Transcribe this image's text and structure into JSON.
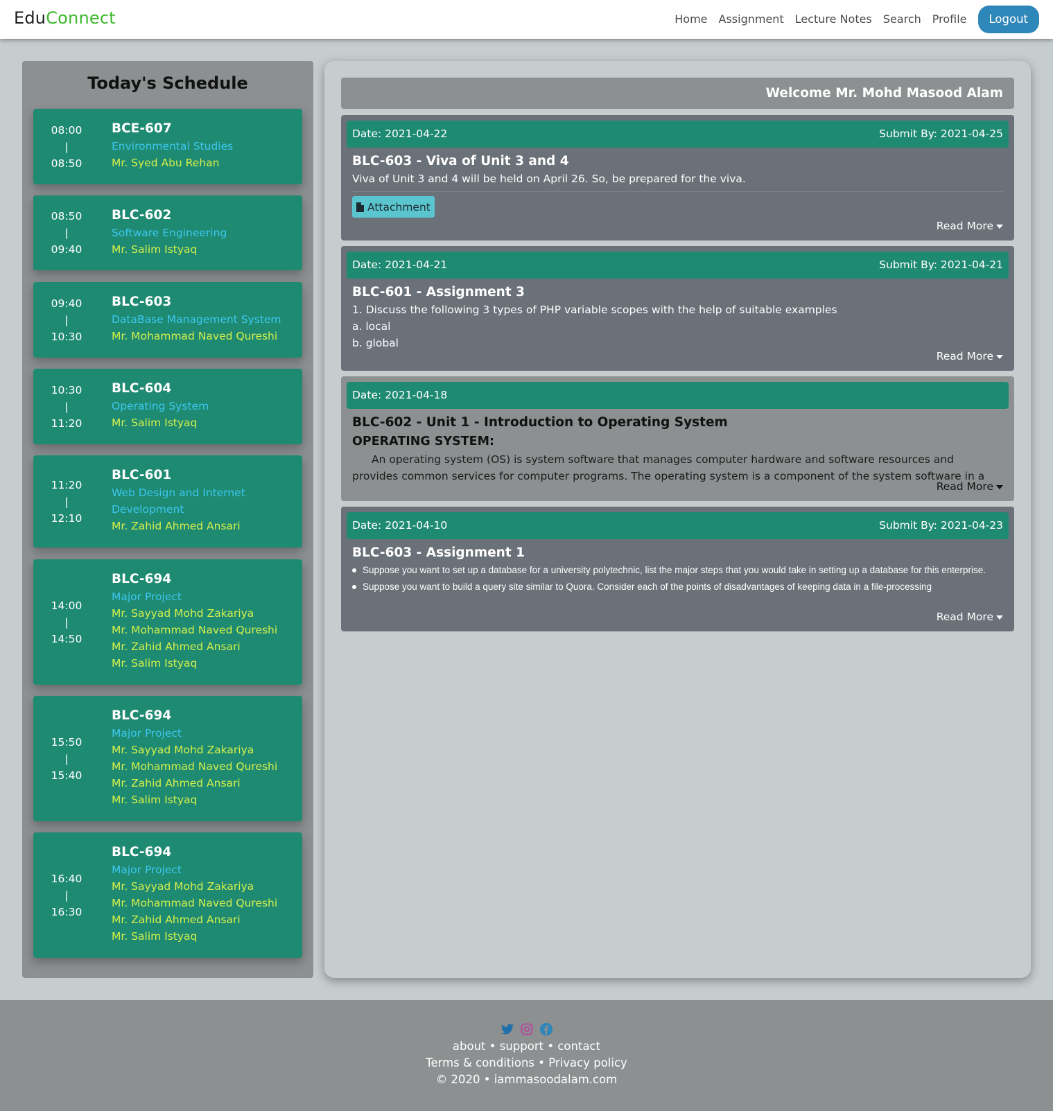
{
  "brand": {
    "part1": "Edu",
    "part2": "Connect"
  },
  "nav": {
    "links": [
      "Home",
      "Assignment",
      "Lecture Notes",
      "Search",
      "Profile"
    ],
    "logout": "Logout"
  },
  "schedule": {
    "title": "Today's Schedule",
    "items": [
      {
        "start": "08:00",
        "sep": "|",
        "end": "08:50",
        "code": "BCE-607",
        "subject": "Environmental Studies",
        "teachers": [
          "Mr. Syed Abu Rehan"
        ]
      },
      {
        "start": "08:50",
        "sep": "|",
        "end": "09:40",
        "code": "BLC-602",
        "subject": "Software Engineering",
        "teachers": [
          "Mr. Salim Istyaq"
        ]
      },
      {
        "start": "09:40",
        "sep": "|",
        "end": "10:30",
        "code": "BLC-603",
        "subject": "DataBase Management System",
        "teachers": [
          "Mr. Mohammad Naved Qureshi"
        ]
      },
      {
        "start": "10:30",
        "sep": "|",
        "end": "11:20",
        "code": "BLC-604",
        "subject": "Operating System",
        "teachers": [
          "Mr. Salim Istyaq"
        ]
      },
      {
        "start": "11:20",
        "sep": "|",
        "end": "12:10",
        "code": "BLC-601",
        "subject": "Web Design and Internet Development",
        "teachers": [
          "Mr. Zahid Ahmed Ansari"
        ]
      },
      {
        "start": "14:00",
        "sep": "|",
        "end": "14:50",
        "code": "BLC-694",
        "subject": "Major Project",
        "teachers": [
          "Mr. Sayyad Mohd Zakariya",
          "Mr. Mohammad Naved Qureshi",
          "Mr. Zahid Ahmed Ansari",
          "Mr. Salim Istyaq"
        ]
      },
      {
        "start": "15:50",
        "sep": "|",
        "end": "15:40",
        "code": "BLC-694",
        "subject": "Major Project",
        "teachers": [
          "Mr. Sayyad Mohd Zakariya",
          "Mr. Mohammad Naved Qureshi",
          "Mr. Zahid Ahmed Ansari",
          "Mr. Salim Istyaq"
        ]
      },
      {
        "start": "16:40",
        "sep": "|",
        "end": "16:30",
        "code": "BLC-694",
        "subject": "Major Project",
        "teachers": [
          "Mr. Sayyad Mohd Zakariya",
          "Mr. Mohammad Naved Qureshi",
          "Mr. Zahid Ahmed Ansari",
          "Mr. Salim Istyaq"
        ]
      }
    ]
  },
  "welcome": "Welcome Mr. Mohd Masood Alam",
  "notices": [
    {
      "date": "Date: 2021-04-22",
      "submit": "Submit By: 2021-04-25",
      "title": "BLC-603 - Viva of Unit 3 and 4",
      "text": "Viva of Unit 3 and 4 will be held on April 26. So, be prepared for the viva.",
      "attachment": "Attachment",
      "read_more": "Read More"
    },
    {
      "date": "Date: 2021-04-21",
      "submit": "Submit By: 2021-04-21",
      "title": "BLC-601 - Assignment 3",
      "lines": [
        "1.  Discuss the following 3 types of PHP variable scopes with the help of suitable examples",
        "a. local",
        "b. global"
      ],
      "read_more": "Read More"
    },
    {
      "date": "Date: 2021-04-18",
      "title": "BLC-602 - Unit 1 - Introduction to Operating System",
      "heading": "OPERATING SYSTEM:",
      "text": "An operating system (OS) is system software that manages computer hardware and software resources and provides common services for computer programs. The operating system is a component of the system software in a",
      "read_more": "Read More"
    },
    {
      "date": "Date: 2021-04-10",
      "submit": "Submit By: 2021-04-23",
      "title": "BLC-603 - Assignment 1",
      "bullets": [
        "Suppose you want to set up a database for a university polytechnic, list the major steps that you would take in setting up a database for this enterprise.",
        "Suppose you want to build a query site similar to Quora. Consider each of the points of disadvantages of keeping data in a file-processing"
      ],
      "read_more": "Read More"
    }
  ],
  "footer": {
    "socials": [
      "twitter-icon",
      "instagram-icon",
      "facebook-icon"
    ],
    "links1": [
      "about",
      "support",
      "contact"
    ],
    "links2": [
      "Terms & conditions",
      "Privacy policy"
    ],
    "copyright": "© 2020",
    "site": "iammasoodalam.com",
    "separator": " • "
  }
}
